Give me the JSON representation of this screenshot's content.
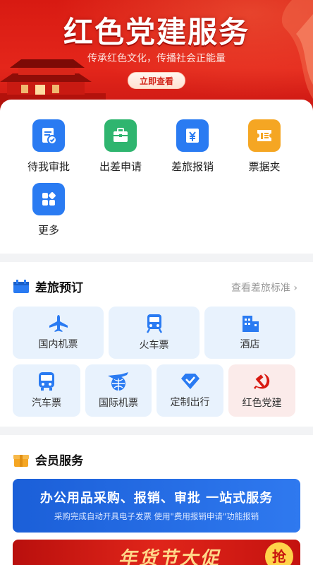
{
  "banner": {
    "title": "红色党建服务",
    "subtitle": "传承红色文化，传播社会正能量",
    "button_label": "立即查看"
  },
  "quick_actions": [
    {
      "label": "待我审批",
      "icon": "approval-doc-icon",
      "color": "#2a7bf2"
    },
    {
      "label": "出差申请",
      "icon": "briefcase-icon",
      "color": "#2fb56f"
    },
    {
      "label": "差旅报销",
      "icon": "yuan-reimburse-icon",
      "color": "#2a7bf2"
    },
    {
      "label": "票据夹",
      "icon": "ticket-folder-icon",
      "color": "#f5a623"
    },
    {
      "label": "更多",
      "icon": "more-grid-icon",
      "color": "#2a7bf2"
    }
  ],
  "travel": {
    "title": "差旅预订",
    "link": "查看差旅标准",
    "tiles_row1": [
      {
        "label": "国内机票",
        "icon": "airplane-icon"
      },
      {
        "label": "火车票",
        "icon": "train-icon"
      },
      {
        "label": "酒店",
        "icon": "hotel-icon"
      }
    ],
    "tiles_row2": [
      {
        "label": "汽车票",
        "icon": "bus-icon"
      },
      {
        "label": "国际机票",
        "icon": "globe-plane-icon"
      },
      {
        "label": "定制出行",
        "icon": "diamond-check-icon"
      },
      {
        "label": "红色党建",
        "icon": "hammer-sickle-icon"
      }
    ]
  },
  "member": {
    "title": "会员服务",
    "promo_title": "办公用品采购、报销、审批 一站式服务",
    "promo_sub": "采购完成自动开具电子发票 使用\"费用报销申请\"功能报销",
    "promo2_text": "年货节大促",
    "promo2_badge": "抢"
  },
  "colors": {
    "brand_blue": "#2a7bf2",
    "party_red": "#d81a12",
    "tile_bg": "#e8f2fd"
  }
}
